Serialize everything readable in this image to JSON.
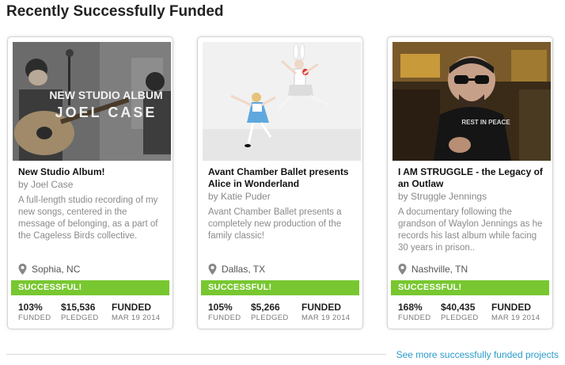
{
  "section": {
    "title": "Recently Successfully Funded"
  },
  "projects": [
    {
      "image_overlay_line1": "NEW STUDIO ALBUM",
      "image_overlay_line2": "JOEL CASE",
      "title": "New Studio Album!",
      "creator": "by Joel Case",
      "description": "A full-length studio recording of my new songs, centered in the message of belonging, as a part of the Cageless Birds collective.",
      "location": "Sophia, NC",
      "status": "SUCCESSFUL!",
      "funded_pct": "103%",
      "funded_label": "FUNDED",
      "pledged": "$15,536",
      "pledged_label": "PLEDGED",
      "state": "FUNDED",
      "date": "MAR 19 2014"
    },
    {
      "title": "Avant Chamber Ballet presents Alice in Wonderland",
      "creator": "by Katie Puder",
      "description": "Avant Chamber Ballet presents a completely new production of the family classic!",
      "location": "Dallas, TX",
      "status": "SUCCESSFUL!",
      "funded_pct": "105%",
      "funded_label": "FUNDED",
      "pledged": "$5,266",
      "pledged_label": "PLEDGED",
      "state": "FUNDED",
      "date": "MAR 19 2014"
    },
    {
      "image_shirt_text": "REST IN PEACE",
      "title": "I AM STRUGGLE - the Legacy of an Outlaw",
      "creator": "by Struggle Jennings",
      "description": "A documentary following the grandson of Waylon Jennings as he records his last album while facing 30 years in prison..",
      "location": "Nashville, TN",
      "status": "SUCCESSFUL!",
      "funded_pct": "168%",
      "funded_label": "FUNDED",
      "pledged": "$40,435",
      "pledged_label": "PLEDGED",
      "state": "FUNDED",
      "date": "MAR 19 2014"
    }
  ],
  "footer": {
    "see_more": "See more successfully funded projects"
  },
  "colors": {
    "success_green": "#78c730",
    "link_blue": "#2a9ccc"
  }
}
